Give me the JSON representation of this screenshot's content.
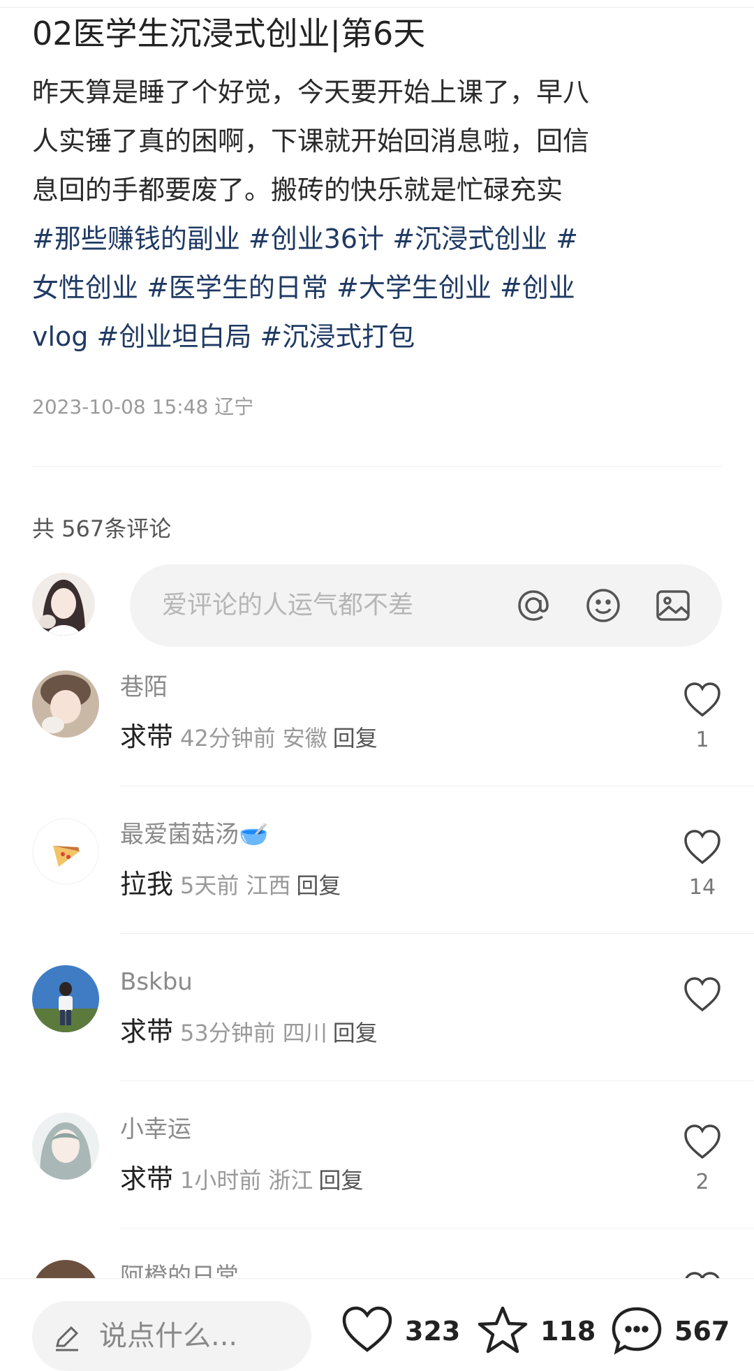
{
  "post": {
    "title": "02医学生沉浸式创业|第6天",
    "body_lines": [
      "昨天算是睡了个好觉，今天要开始上课了，早八",
      "人实锤了真的困啊，下课就开始回消息啦，回信",
      "息回的手都要废了。搬砖的快乐就是忙碌充实"
    ],
    "tag_lines": [
      "#那些赚钱的副业 #创业36计 #沉浸式创业 #",
      "女性创业 #医学生的日常 #大学生创业 #创业",
      "vlog #创业坦白局 #沉浸式打包"
    ],
    "meta": "2023-10-08 15:48 辽宁"
  },
  "comments_header": {
    "count_label": "共 567条评论",
    "input_placeholder": "爱评论的人运气都不差"
  },
  "comments": [
    {
      "name": "巷陌",
      "text": "求带",
      "time": "42分钟前",
      "location": "安徽",
      "reply": "回复",
      "likes": "1"
    },
    {
      "name": "最爱菌菇汤🥣",
      "text": "拉我",
      "time": "5天前",
      "location": "江西",
      "reply": "回复",
      "likes": "14"
    },
    {
      "name": "Bskbu",
      "text": "求带",
      "time": "53分钟前",
      "location": "四川",
      "reply": "回复",
      "likes": ""
    },
    {
      "name": "小幸运",
      "text": "求带",
      "time": "1小时前",
      "location": "浙江",
      "reply": "回复",
      "likes": "2"
    },
    {
      "name": "阿橙的日常",
      "text": "",
      "time": "",
      "location": "",
      "reply": "",
      "likes": ""
    }
  ],
  "bottom_bar": {
    "say_placeholder": "说点什么...",
    "likes": "323",
    "favorites": "118",
    "comments": "567"
  },
  "colors": {
    "tag": "#1f3a63",
    "muted": "#9a9a9a",
    "input_bg": "#f3f3f3"
  },
  "icons": {
    "comment_input": [
      "at-icon",
      "emoji-icon",
      "image-icon"
    ],
    "bottom": [
      "edit-icon",
      "heart-icon",
      "star-icon",
      "chat-icon"
    ]
  }
}
